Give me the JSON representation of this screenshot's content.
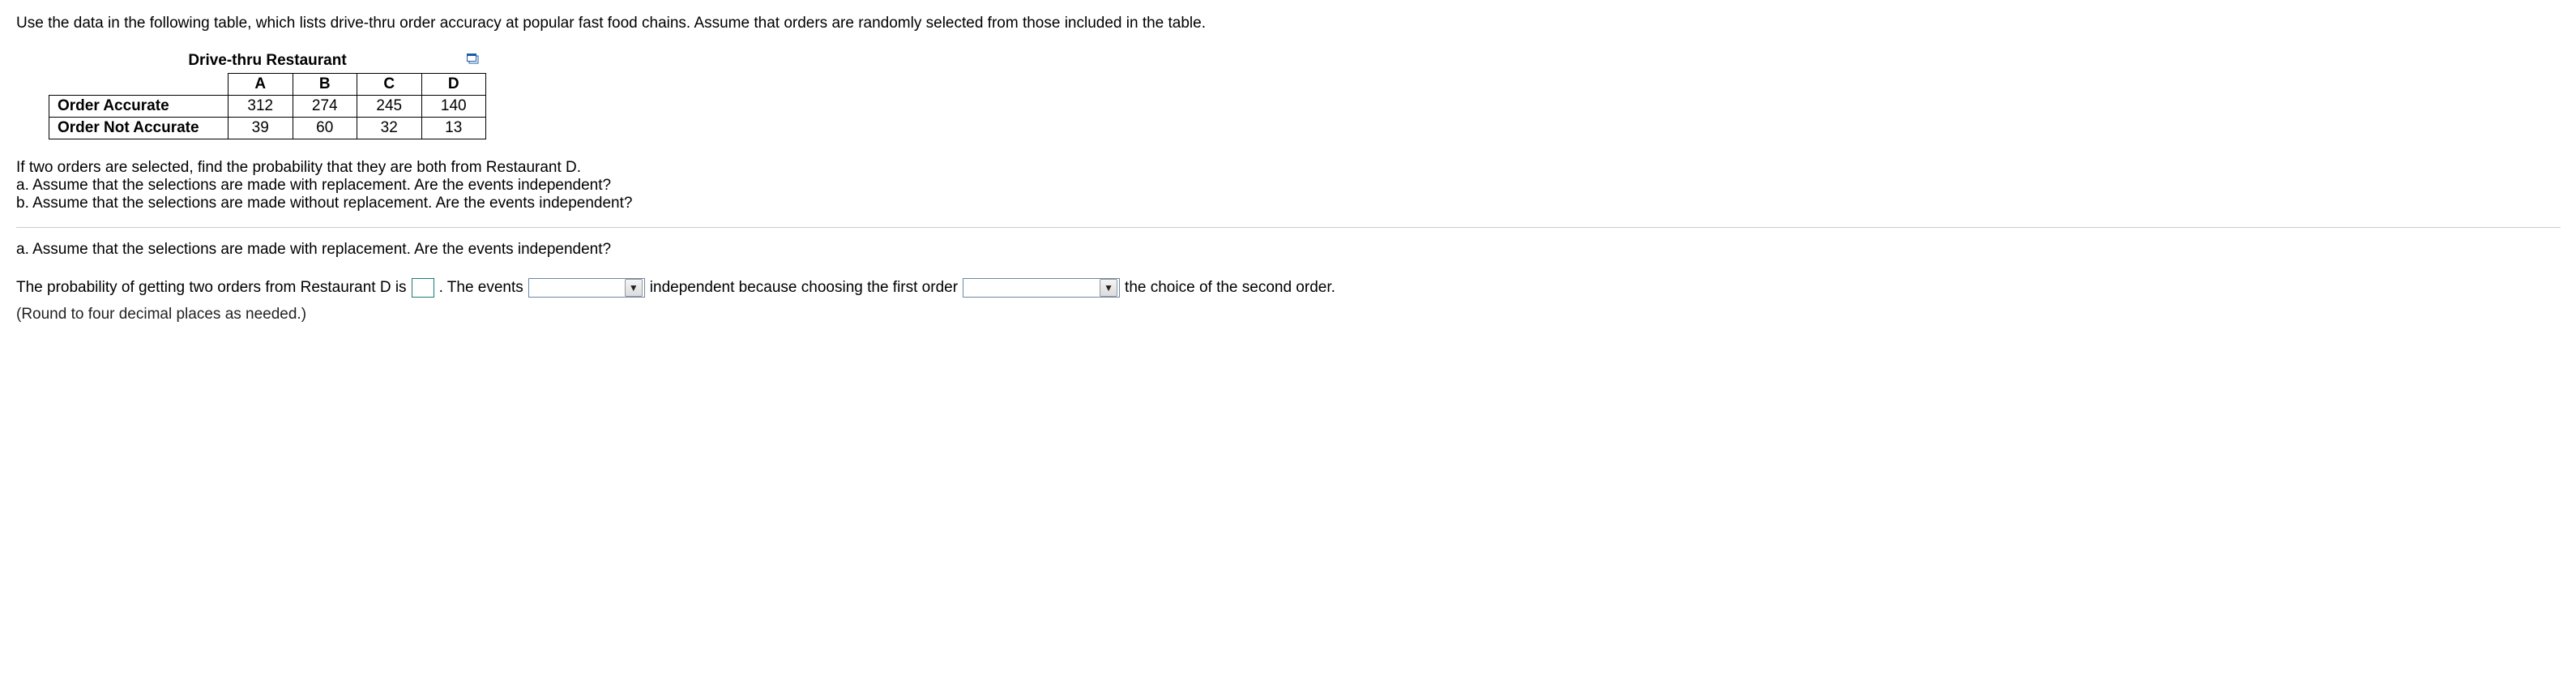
{
  "intro": "Use the data in the following table, which lists drive-thru order accuracy at popular fast food chains. Assume that orders are randomly selected from those included in the table.",
  "table": {
    "title": "Drive-thru Restaurant",
    "columns": [
      "A",
      "B",
      "C",
      "D"
    ],
    "rows": [
      {
        "label": "Order Accurate",
        "values": [
          312,
          274,
          245,
          140
        ]
      },
      {
        "label": "Order Not Accurate",
        "values": [
          39,
          60,
          32,
          13
        ]
      }
    ]
  },
  "question": {
    "stem": "If two orders are selected, find the probability that they are both from Restaurant D.",
    "parts": {
      "a": "a. Assume that the selections are made with replacement. Are the events independent?",
      "b": "b. Assume that the selections are made without replacement. Are the events independent?"
    }
  },
  "part_a": {
    "prompt": "a. Assume that the selections are made with replacement. Are the events independent?",
    "sentence": {
      "s1": "The probability of getting two orders from Restaurant D is",
      "s2": ". The events",
      "s3": "independent because choosing the first order",
      "s4": "the choice of the second order."
    },
    "hint": "(Round to four decimal places as needed.)",
    "dropdown_arrow": "▼"
  },
  "chart_data": {
    "type": "table",
    "title": "Drive-thru Restaurant",
    "columns": [
      "",
      "A",
      "B",
      "C",
      "D"
    ],
    "rows": [
      [
        "Order Accurate",
        312,
        274,
        245,
        140
      ],
      [
        "Order Not Accurate",
        39,
        60,
        32,
        13
      ]
    ]
  }
}
